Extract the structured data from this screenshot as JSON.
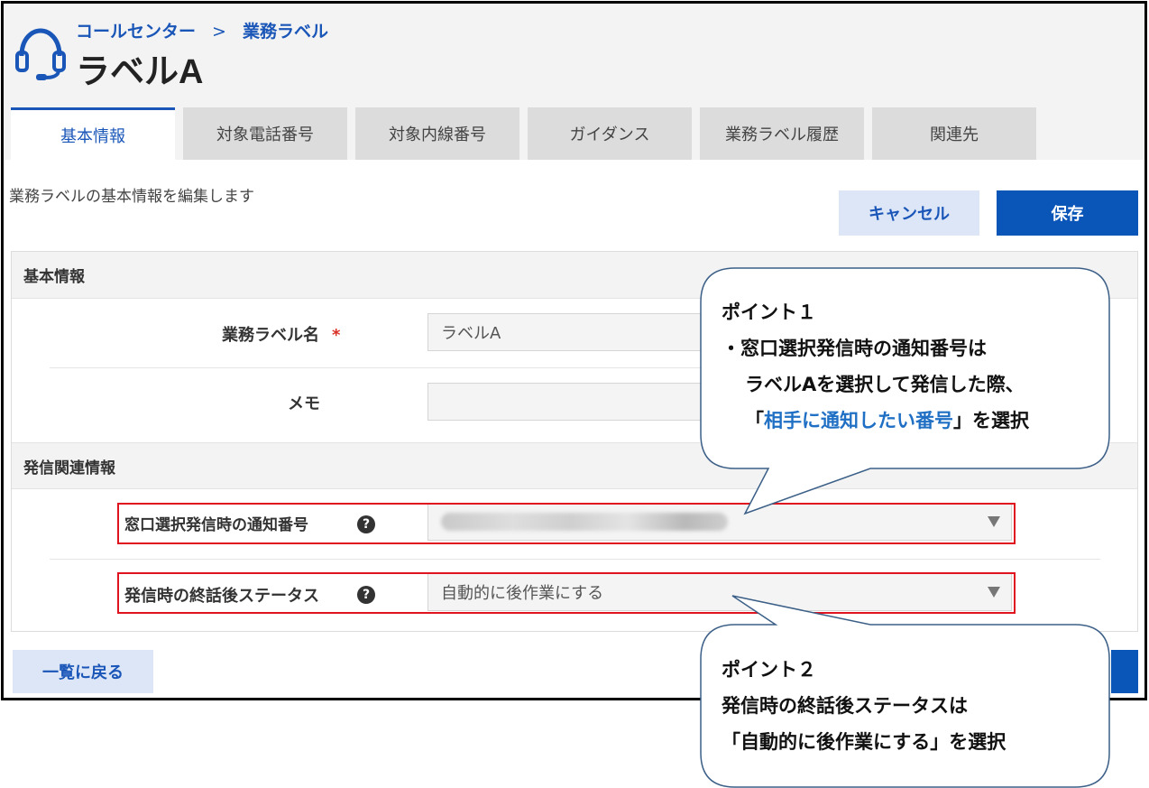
{
  "header": {
    "breadcrumb": {
      "parent": "コールセンター",
      "separator": ">",
      "current": "業務ラベル"
    },
    "title": "ラベルA",
    "icon": "headset-icon"
  },
  "tabs": [
    {
      "label": "基本情報",
      "active": true
    },
    {
      "label": "対象電話番号",
      "active": false
    },
    {
      "label": "対象内線番号",
      "active": false
    },
    {
      "label": "ガイダンス",
      "active": false
    },
    {
      "label": "業務ラベル履歴",
      "active": false
    },
    {
      "label": "関連先",
      "active": false
    }
  ],
  "content": {
    "description": "業務ラベルの基本情報を編集します",
    "cancel_label": "キャンセル",
    "save_label": "保存",
    "back_label": "一覧に戻る"
  },
  "basic_section": {
    "title": "基本情報",
    "name_label": "業務ラベル名",
    "required_mark": "*",
    "name_value": "ラベルA",
    "memo_label": "メモ",
    "memo_value": ""
  },
  "outbound_section": {
    "title": "発信関連情報",
    "notify_number_label": "窓口選択発信時の通知番号",
    "notify_number_value": "",
    "after_call_label": "発信時の終話後ステータス",
    "after_call_value": "自動的に後作業にする",
    "help_glyph": "?"
  },
  "callouts": {
    "point1": {
      "title": "ポイント１",
      "line1": "・窓口選択発信時の通知番号は",
      "line2": "ラベルAを選択して発信した際、",
      "line3_open": "「",
      "line3_highlight": "相手に通知したい番号",
      "line3_close": "」を選択"
    },
    "point2": {
      "title": "ポイント２",
      "line1": "発信時の終話後ステータスは",
      "line2": "「自動的に後作業にする」を選択"
    }
  },
  "colors": {
    "accent": "#1a56b8",
    "primary_button": "#0a55b8",
    "highlight_box": "#e0141e",
    "callout_border": "#3b5f87",
    "callout_highlight_text": "#1f6fc4"
  }
}
